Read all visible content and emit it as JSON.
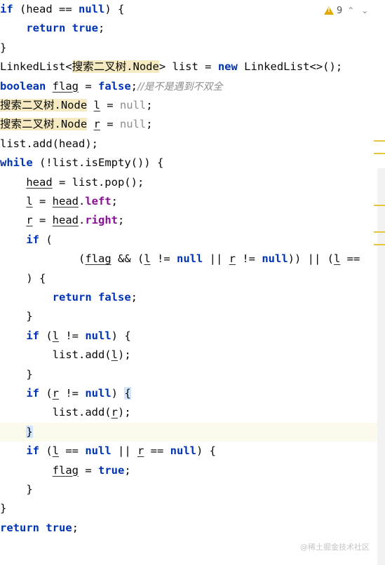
{
  "inspection": {
    "warning_count": "9",
    "up_label": "^",
    "down_label": "v"
  },
  "code": {
    "l1": {
      "kw": "if",
      "a": " (head == ",
      "null": "null",
      "b": ") {"
    },
    "l2": {
      "ind": "    ",
      "kw": "return",
      "sp": " ",
      "val": "true",
      "end": ";"
    },
    "l3": {
      "text": "}"
    },
    "l4": {
      "a": "LinkedList<",
      "type": "搜索二叉树",
      "dot": ".Node",
      "b": "> list = ",
      "kw": "new",
      "c": " LinkedList<>();"
    },
    "l5": {
      "kw": "boolean",
      "sp": " ",
      "var": "flag",
      "eq": " = ",
      "val": "false",
      "semi": ";",
      "comment": "//是不是遇到不双全"
    },
    "l6": {
      "type": "搜索二叉树.Node",
      "sp": " ",
      "var": "l",
      "eq": " = ",
      "val": "null",
      "semi": ";"
    },
    "l7": {
      "type": "搜索二叉树.Node",
      "sp": " ",
      "var": "r",
      "eq": " = ",
      "val": "null",
      "semi": ";"
    },
    "l8": {
      "text": "list.add(head);"
    },
    "l9": {
      "kw": "while",
      "a": " (!list.isEmpty()) {"
    },
    "l10": {
      "ind": "    ",
      "var": "head",
      "a": " = list.pop();"
    },
    "l11": {
      "ind": "    ",
      "var": "l",
      "eq": " = ",
      "obj": "head",
      "dot": ".",
      "field": "left",
      "semi": ";"
    },
    "l12": {
      "ind": "    ",
      "var": "r",
      "eq": " = ",
      "obj": "head",
      "dot": ".",
      "field": "right",
      "semi": ";"
    },
    "l13": {
      "ind": "    ",
      "kw": "if",
      "a": " ("
    },
    "l14": {
      "ind": "            ",
      "a": "(",
      "v1": "flag",
      "b": " && (",
      "v2": "l",
      "c": " != ",
      "n1": "null",
      "d": " || ",
      "v3": "r",
      "e": " != ",
      "n2": "null",
      "f": ")) || (",
      "v4": "l",
      "g": " =="
    },
    "l15": {
      "ind": "    ",
      "a": ") {"
    },
    "l16": {
      "ind": "        ",
      "kw": "return",
      "sp": " ",
      "val": "false",
      "end": ";"
    },
    "l17": {
      "ind": "    ",
      "a": "}"
    },
    "l18": {
      "ind": "    ",
      "kw": "if",
      "a": " (",
      "var": "l",
      "b": " != ",
      "null": "null",
      "c": ") {"
    },
    "l19": {
      "ind": "        ",
      "a": "list.add(",
      "var": "l",
      "b": ");"
    },
    "l20": {
      "ind": "    ",
      "a": "}"
    },
    "l21": {
      "ind": "    ",
      "kw": "if",
      "a": " (",
      "var": "r",
      "b": " != ",
      "null": "null",
      "c": ") ",
      "brace": "{"
    },
    "l22": {
      "ind": "        ",
      "a": "list.add(",
      "var": "r",
      "b": ");"
    },
    "l23": {
      "ind": "    ",
      "brace": "}"
    },
    "l24": {
      "ind": "    ",
      "kw": "if",
      "a": " (",
      "v1": "l",
      "b": " == ",
      "n1": "null",
      "c": " || ",
      "v2": "r",
      "d": " == ",
      "n2": "null",
      "e": ") {"
    },
    "l25": {
      "ind": "        ",
      "var": "flag",
      "eq": " = ",
      "val": "true",
      "semi": ";"
    },
    "l26": {
      "ind": "    ",
      "a": "}"
    },
    "l27": {
      "text": "}"
    },
    "l28": {
      "kw": "return",
      "sp": " ",
      "val": "true",
      "end": ";"
    }
  },
  "watermark": "@稀土掘金技术社区"
}
